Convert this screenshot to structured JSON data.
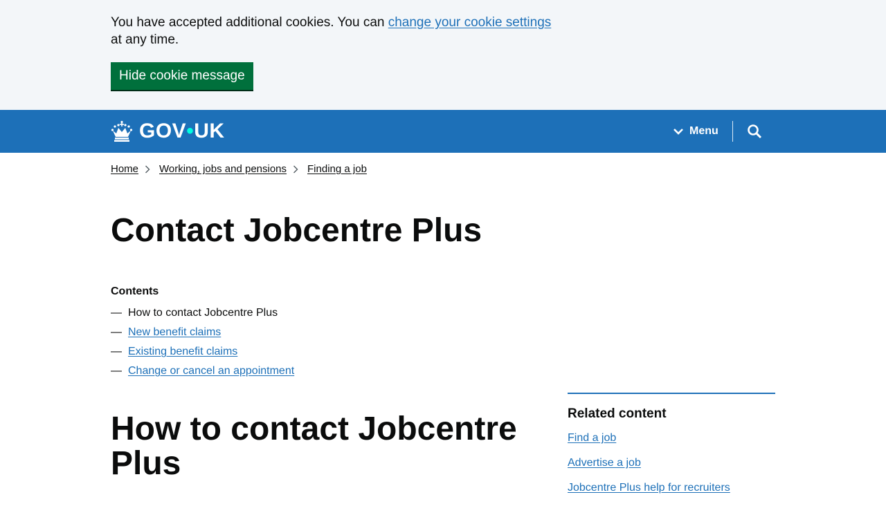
{
  "cookie_banner": {
    "text_before": "You have accepted additional cookies. You can ",
    "link": "change your cookie settings",
    "text_after": " at any time.",
    "button": "Hide cookie message"
  },
  "header": {
    "logo_text_1": "GOV",
    "logo_dot": "•",
    "logo_text_2": "UK",
    "menu_label": "Menu",
    "colors": {
      "header_bg": "#1d70b8",
      "dot": "#00ffe0"
    }
  },
  "breadcrumbs": [
    "Home",
    "Working, jobs and pensions",
    "Finding a job"
  ],
  "page_title": "Contact Jobcentre Plus",
  "contents": {
    "label": "Contents",
    "dash": "—",
    "items": [
      "How to contact Jobcentre Plus",
      "New benefit claims",
      "Existing benefit claims",
      "Change or cancel an appointment"
    ]
  },
  "section_heading": "How to contact Jobcentre Plus",
  "related": {
    "title": "Related content",
    "links": [
      "Find a job",
      "Advertise a job",
      "Jobcentre Plus help for recruiters"
    ]
  }
}
